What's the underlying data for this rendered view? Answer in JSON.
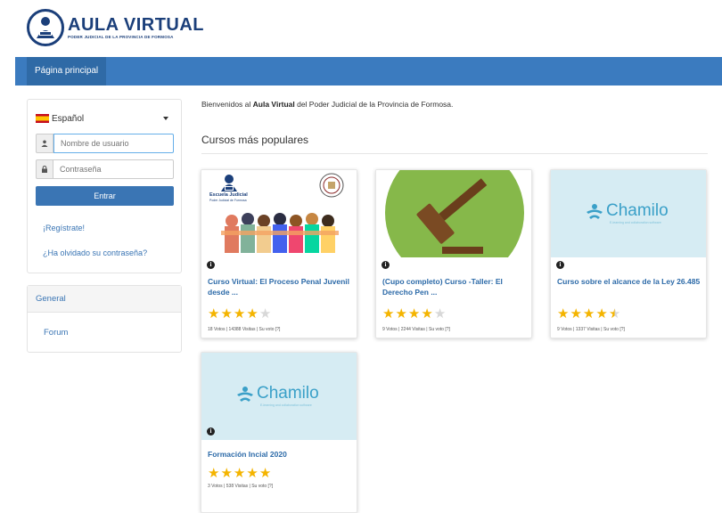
{
  "brand": {
    "title": "AULA VIRTUAL",
    "subtitle": "PODER JUDICIAL DE LA PROVINCIA DE FORMOSA",
    "color": "#1b3f7a"
  },
  "nav": {
    "home_label": "Página principal",
    "bar_color": "#3b7bbf"
  },
  "login": {
    "language": "Español",
    "username_placeholder": "Nombre de usuario",
    "password_placeholder": "Contraseña",
    "submit_label": "Entrar",
    "register_label": "¡Regístrate!",
    "forgot_label": "¿Ha olvidado su contraseña?",
    "user_icon": "user-icon",
    "lock_icon": "lock-icon"
  },
  "general": {
    "heading": "General",
    "forum_label": "Forum"
  },
  "main": {
    "welcome_prefix": "Bienvenidos al ",
    "welcome_bold": "Aula Virtual",
    "welcome_suffix": " del Poder Judicial de la Provincia de Formosa.",
    "section_title": "Cursos más populares"
  },
  "courses": [
    {
      "title": "Curso Virtual: El Proceso Penal Juvenil desde ...",
      "rating": 4,
      "votes_text": "18 Votos | 14388 Visitas | Su voto [?]",
      "image": "escuela-judicial-illustration",
      "image_caption": "Escuela Judicial",
      "image_sub": "Poder Judicial de Formosa"
    },
    {
      "title": "(Cupo completo) Curso -Taller: El Derecho Pen ...",
      "rating": 4,
      "votes_text": "9 Votos | 2244 Visitas | Su voto [?]",
      "image": "gavel-illustration"
    },
    {
      "title": "Curso sobre el alcance de la Ley 26.485",
      "rating": 4.5,
      "votes_text": "9 Votos | 1337 Visitas | Su voto [?]",
      "image": "chamilo-placeholder",
      "image_caption": "Chamilo",
      "image_sub": "E-learning and collaboration software"
    },
    {
      "title": "Formación Incial 2020",
      "rating": 5,
      "votes_text": "3 Votos | 538 Visitas | Su voto [?]",
      "image": "chamilo-placeholder",
      "image_caption": "Chamilo",
      "image_sub": "E-learning and collaboration software"
    }
  ],
  "colors": {
    "link": "#3a75b4",
    "star": "#f4b400",
    "course_title": "#2c6aa8"
  }
}
